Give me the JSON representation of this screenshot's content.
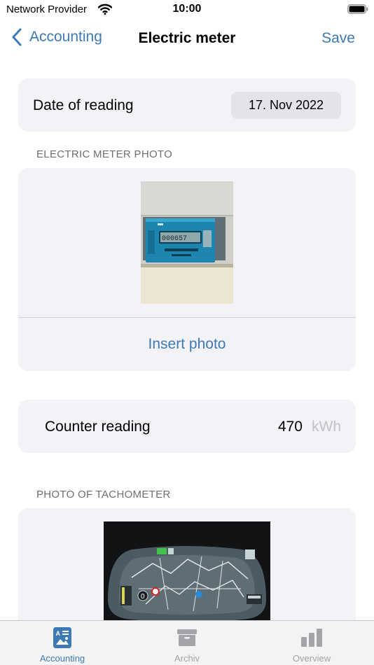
{
  "status_bar": {
    "carrier": "Network Provider",
    "time": "10:00",
    "icons": [
      "wifi-icon",
      "battery-icon"
    ]
  },
  "nav": {
    "back_label": "Accounting",
    "title": "Electric meter",
    "save_label": "Save"
  },
  "date_row": {
    "label": "Date of reading",
    "value": "17. Nov 2022"
  },
  "meter_photo_section": {
    "header": "ELECTRIC METER PHOTO",
    "insert_label": "Insert photo"
  },
  "counter": {
    "label": "Counter reading",
    "value": "470",
    "unit": "kWh"
  },
  "tacho_section": {
    "header": "PHOTO OF TACHOMETER"
  },
  "tabs": [
    {
      "label": "Accounting",
      "icon": "accounting-icon",
      "selected": true
    },
    {
      "label": "Archiv",
      "icon": "archive-box-icon",
      "selected": false
    },
    {
      "label": "Overview",
      "icon": "bar-chart-icon",
      "selected": false
    }
  ],
  "colors": {
    "accent": "#3d7ab5",
    "card_background": "#f2f2f7",
    "tab_active": "#3d7ab5",
    "tab_inactive": "#a3a3a8"
  }
}
